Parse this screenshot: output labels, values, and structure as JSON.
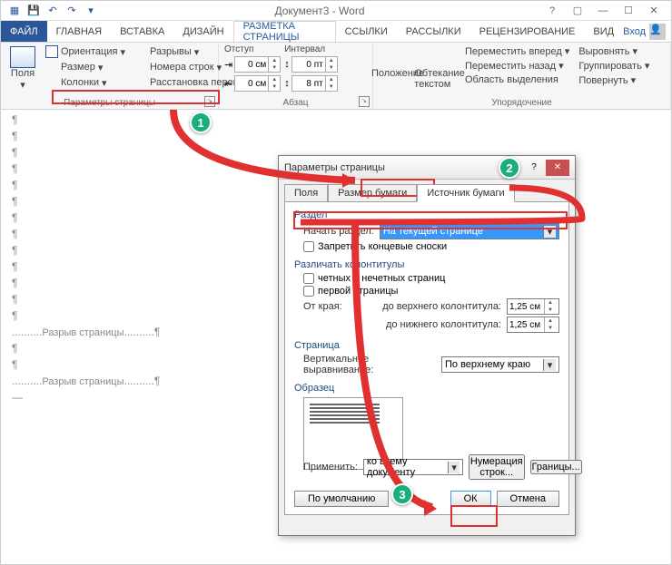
{
  "app": {
    "title": "Документ3 - Word",
    "login": "Вход"
  },
  "qat": [
    "word-icon",
    "save",
    "undo",
    "redo",
    "customize"
  ],
  "tabs": {
    "file": "ФАЙЛ",
    "home": "ГЛАВНАЯ",
    "insert": "ВСТАВКА",
    "design": "ДИЗАЙН",
    "layout": "РАЗМЕТКА СТРАНИЦЫ",
    "refs": "ССЫЛКИ",
    "mail": "РАССЫЛКИ",
    "review": "РЕЦЕНЗИРОВАНИЕ",
    "view": "ВИД"
  },
  "ribbon": {
    "page_setup": {
      "title": "Параметры страницы",
      "margins": "Поля",
      "orientation": "Ориентация",
      "size": "Размер",
      "columns": "Колонки",
      "breaks": "Разрывы",
      "lines": "Номера строк",
      "hyphen": "Расстановка переносов"
    },
    "paragraph": {
      "title": "Абзац",
      "indent": "Отступ",
      "spacing": "Интервал",
      "left": "0 см",
      "right": "0 см",
      "before": "0 пт",
      "after": "8 пт"
    },
    "arrange": {
      "title": "Упорядочение",
      "position": "Положение",
      "wrap": "Обтекание текстом",
      "forward": "Переместить вперед",
      "backward": "Переместить назад",
      "selection": "Область выделения",
      "align": "Выровнять",
      "group": "Группировать",
      "rotate": "Повернуть"
    }
  },
  "doc": {
    "break_text": "Разрыв страницы"
  },
  "dialog": {
    "title": "Параметры страницы",
    "tabs": {
      "fields": "Поля",
      "size": "Размер бумаги",
      "source": "Источник бумаги"
    },
    "section_h": "Раздел",
    "start_section": "Начать раздел:",
    "start_section_val": "На текущей странице",
    "suppress": "Запретить концевые сноски",
    "headers_h": "Различать колонтитулы",
    "odd_even": "четных и нечетных страниц",
    "first_page": "первой страницы",
    "from_edge": "От края:",
    "to_header": "до верхнего колонтитула:",
    "to_footer": "до нижнего колонтитула:",
    "dist_val": "1,25 см",
    "page_h": "Страница",
    "valign": "Вертикальное выравнивание:",
    "valign_val": "По верхнему краю",
    "preview_h": "Образец",
    "apply": "Применить:",
    "apply_val": "ко всему документу",
    "line_nums": "Нумерация строк...",
    "borders": "Границы...",
    "default": "По умолчанию",
    "ok": "ОК",
    "cancel": "Отмена"
  },
  "callouts": {
    "c1": "1",
    "c2": "2",
    "c3": "3"
  }
}
